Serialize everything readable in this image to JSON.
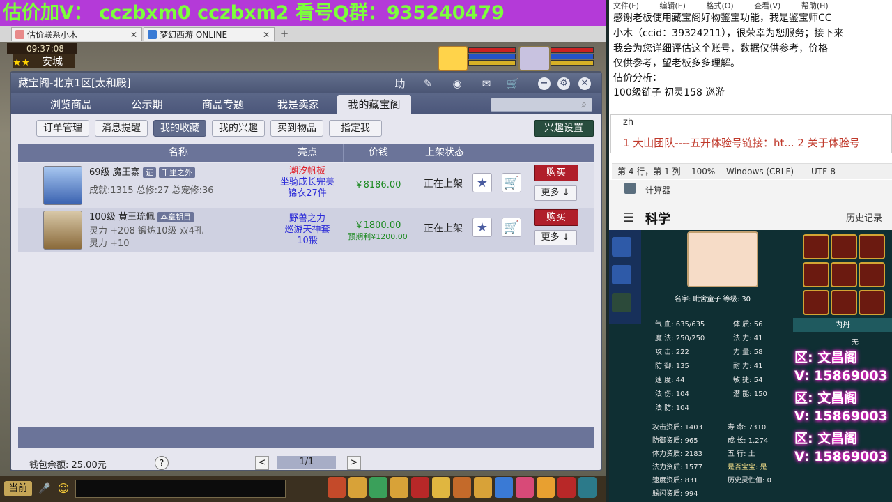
{
  "banner": {
    "text": "估价加V： cczbxm0   cczbxm2   看号Q群：935240479"
  },
  "browser": {
    "tabs": [
      {
        "label": "估价联系小木"
      },
      {
        "label": "梦幻西游 ONLINE"
      }
    ],
    "new_tab_symbol": "+"
  },
  "game_hud": {
    "time": "09:37:08",
    "city": "安城"
  },
  "window": {
    "title": "藏宝阁-北京1区[太和殿]",
    "help_label": "助",
    "nav_tabs": [
      "浏览商品",
      "公示期",
      "商品专题",
      "我是卖家",
      "我的藏宝阁"
    ],
    "active_nav": "我的藏宝阁",
    "sub_tabs": [
      "订单管理",
      "消息提醒",
      "我的收藏",
      "我的兴趣",
      "买到物品",
      "指定我"
    ],
    "active_sub": "我的收藏",
    "interest_button": "兴趣设置",
    "table_headers": [
      "名称",
      "亮点",
      "价钱",
      "上架状态"
    ],
    "items": [
      {
        "level_name": "69级  魔王寨",
        "badge1": "证",
        "badge2": "千里之外",
        "detail_line": "成就:1315 总修:27 总宠修:36",
        "highlights": [
          "潮汐帆板",
          "坐骑成长完美",
          "锦衣27件"
        ],
        "highlight_colors": [
          "#e0202a",
          "#2c2cd8",
          "#2c2cd8"
        ],
        "price": "￥8186.00",
        "price2": "",
        "status": "正在上架",
        "buy_label": "购买",
        "more_label": "更多 ↓"
      },
      {
        "level_name": "100级  黄王琉佩",
        "badge1": "本章钥目",
        "badge2": "",
        "detail_line": "灵力 +208  锻炼10级  双4孔",
        "detail_line2": "灵力 +10",
        "highlights": [
          "野兽之力",
          "巡游天神套",
          "10锻"
        ],
        "highlight_colors": [
          "#2c2cd8",
          "#2c2cd8",
          "#2c2cd8"
        ],
        "price": "￥1800.00",
        "price2": "预期利¥1200.00",
        "status": "正在上架",
        "buy_label": "购买",
        "more_label": "更多 ↓"
      }
    ],
    "wallet": "钱包余额: 25.00元",
    "help_icon": "?",
    "pagination": {
      "prev": "<",
      "page": "1/1",
      "next": ">"
    }
  },
  "chat": {
    "button": "当前"
  },
  "notepad": {
    "menu": [
      "文件(F)",
      "编辑(E)",
      "格式(O)",
      "查看(V)",
      "帮助(H)"
    ],
    "lines": [
      "感谢老板使用藏宝阁好物鉴宝功能，我是鉴宝师CC",
      "小木（ccid：39324211），很荣幸为您服务；接下来",
      "我会为您详细评估这个账号，数据仅供参考，价格",
      "仅供参考，望老板多多理解。",
      "估价分析：",
      "100级链子  初灵158   巡游"
    ],
    "ime_code": "zh",
    "ime_candidates": "1 大山团队----五开体验号链接：ht...   2 关于体验号",
    "status": [
      "第 4 行，第 1 列",
      "100%",
      "Windows (CRLF)",
      "UTF-8"
    ]
  },
  "calculator": {
    "title": "计算器",
    "mode": "科学",
    "history": "历史记录"
  },
  "character": {
    "name_line": "名字: 毗舍童子  等级: 30",
    "stats_left": [
      {
        "k": "气  血:",
        "v": "635/635"
      },
      {
        "k": "魔  法:",
        "v": "250/250"
      },
      {
        "k": "攻  击:",
        "v": "222"
      },
      {
        "k": "防  御:",
        "v": "135"
      },
      {
        "k": "速  度:",
        "v": "44"
      },
      {
        "k": "法  伤:",
        "v": "104"
      },
      {
        "k": "法  防:",
        "v": "104"
      }
    ],
    "stats_mid": [
      {
        "k": "体  质:",
        "v": "56"
      },
      {
        "k": "法  力:",
        "v": "41"
      },
      {
        "k": "力  量:",
        "v": "58"
      },
      {
        "k": "耐  力:",
        "v": "41"
      },
      {
        "k": "敏  捷:",
        "v": "54"
      },
      {
        "k": "潜  能:",
        "v": "150"
      }
    ],
    "aptitude_left": [
      {
        "k": "攻击资质:",
        "v": "1403"
      },
      {
        "k": "防御资质:",
        "v": "965"
      },
      {
        "k": "体力资质:",
        "v": "2183"
      },
      {
        "k": "法力资质:",
        "v": "1577"
      },
      {
        "k": "速度资质:",
        "v": "831"
      },
      {
        "k": "躲闪资质:",
        "v": "994"
      }
    ],
    "aptitude_right": [
      {
        "k": "寿    命:",
        "v": "7310"
      },
      {
        "k": "成    长:",
        "v": "1.274"
      },
      {
        "k": "五    行:",
        "v": "土"
      },
      {
        "k": "是否宝宝:",
        "v": "是"
      },
      {
        "k": "历史灵性值:",
        "v": "0"
      }
    ],
    "inner_tab": "内丹",
    "inner_value": "无"
  },
  "promo_overlay": [
    "区: 文昌阁",
    "V: 15869003",
    "区: 文昌阁",
    "V: 15869003",
    "区: 文昌阁",
    "V: 15869003"
  ]
}
